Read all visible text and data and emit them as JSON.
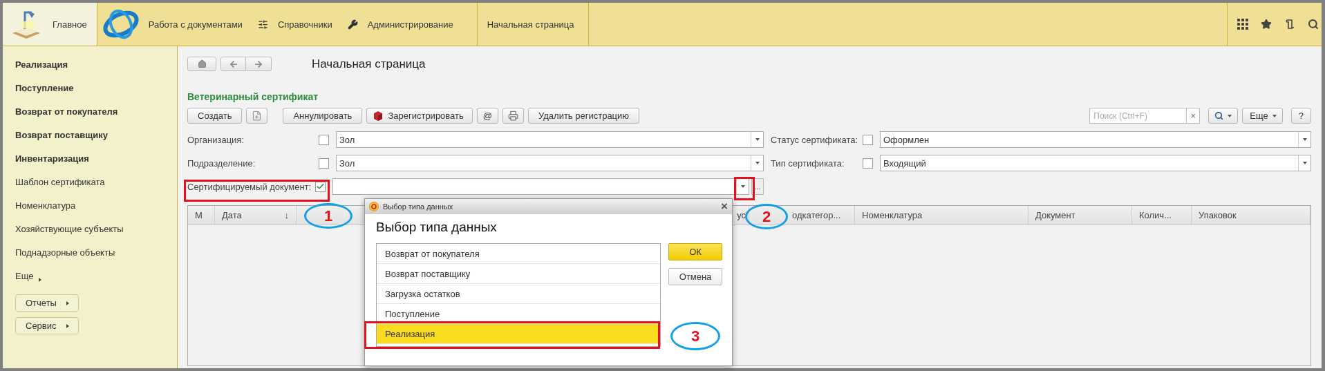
{
  "top_nav": {
    "sections": [
      {
        "label": "Главное",
        "selected": true
      },
      {
        "label": "Работа с документами",
        "selected": false
      },
      {
        "label": "Справочники",
        "selected": false
      },
      {
        "label": "Администрирование",
        "selected": false
      }
    ],
    "open_tab": "Начальная страница"
  },
  "sidebar": {
    "items": [
      {
        "label": "Реализация",
        "bold": true
      },
      {
        "label": "Поступление",
        "bold": true
      },
      {
        "label": "Возврат от покупателя",
        "bold": true
      },
      {
        "label": "Возврат поставщику",
        "bold": true
      },
      {
        "label": "Инвентаризация",
        "bold": true
      },
      {
        "label": "Шаблон сертификата",
        "bold": false
      },
      {
        "label": "Номенклатура",
        "bold": false
      },
      {
        "label": "Хозяйствующие субъекты",
        "bold": false
      },
      {
        "label": "Поднадзорные объекты",
        "bold": false
      }
    ],
    "more": "Еще",
    "buttons": [
      "Отчеты",
      "Сервис"
    ]
  },
  "page_title": "Начальная страница",
  "form_title": "Ветеринарный сертификат",
  "toolbar": {
    "buttons": [
      {
        "kind": "text",
        "label": "Создать"
      },
      {
        "kind": "icon"
      },
      {
        "kind": "text",
        "label": "Аннулировать"
      },
      {
        "kind": "icontext",
        "label": "Зарегистрировать"
      },
      {
        "kind": "text",
        "label": "@"
      },
      {
        "kind": "icon"
      },
      {
        "kind": "text",
        "label": "Удалить регистрацию"
      }
    ],
    "search": {
      "placeholder": "Поиск (Ctrl+F)",
      "clear": "×"
    },
    "more": "Еще",
    "help": "?"
  },
  "filters_left": [
    {
      "label": "Организация:",
      "checked": false,
      "value": "Зол"
    },
    {
      "label": "Подразделение:",
      "checked": false,
      "value": "Зол"
    },
    {
      "label": "Сертифицируемый документ:",
      "checked": true,
      "extra": "..."
    }
  ],
  "filters_right": [
    {
      "label": "Статус сертификата:",
      "checked": false,
      "value": "Оформлен"
    },
    {
      "label": "Тип сертификата:",
      "checked": false,
      "value": "Входящий"
    }
  ],
  "table": {
    "columns": [
      {
        "label": "М"
      },
      {
        "label": "Дата",
        "sort": "↓"
      },
      {
        "label": "ус"
      },
      {
        "label": "одкатегор..."
      },
      {
        "label": "Номенклатура"
      },
      {
        "label": "Документ"
      },
      {
        "label": "Колич..."
      },
      {
        "label": "Упаковок"
      }
    ]
  },
  "dialog": {
    "window_title": "Выбор типа данных",
    "close": "×",
    "heading": "Выбор типа данных",
    "items": [
      {
        "label": "Возврат от покупателя",
        "selected": false
      },
      {
        "label": "Возврат поставщику",
        "selected": false
      },
      {
        "label": "Загрузка остатков",
        "selected": false
      },
      {
        "label": "Поступление",
        "selected": false
      },
      {
        "label": "Реализация",
        "selected": true
      }
    ],
    "buttons": [
      {
        "label": "ОК",
        "kind": "default"
      },
      {
        "label": "Отмена",
        "kind": "normal"
      }
    ]
  },
  "callouts": [
    {
      "number": "1"
    },
    {
      "number": "2"
    },
    {
      "number": "3"
    }
  ]
}
